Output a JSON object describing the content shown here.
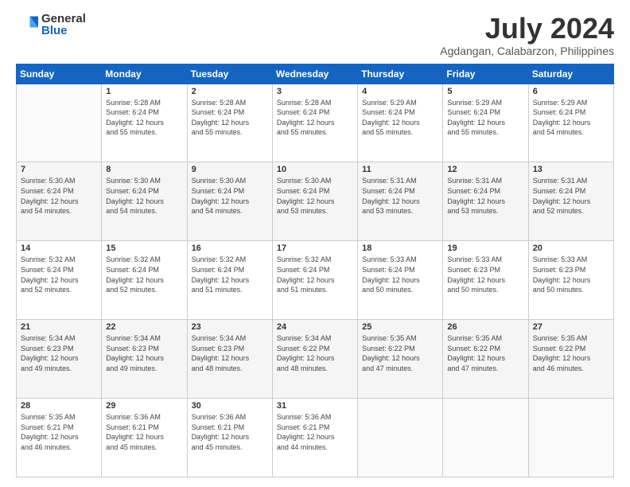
{
  "logo": {
    "general": "General",
    "blue": "Blue"
  },
  "title": "July 2024",
  "location": "Agdangan, Calabarzon, Philippines",
  "weekdays": [
    "Sunday",
    "Monday",
    "Tuesday",
    "Wednesday",
    "Thursday",
    "Friday",
    "Saturday"
  ],
  "weeks": [
    [
      {
        "day": "",
        "sunrise": "",
        "sunset": "",
        "daylight": ""
      },
      {
        "day": "1",
        "sunrise": "Sunrise: 5:28 AM",
        "sunset": "Sunset: 6:24 PM",
        "daylight": "Daylight: 12 hours and 55 minutes."
      },
      {
        "day": "2",
        "sunrise": "Sunrise: 5:28 AM",
        "sunset": "Sunset: 6:24 PM",
        "daylight": "Daylight: 12 hours and 55 minutes."
      },
      {
        "day": "3",
        "sunrise": "Sunrise: 5:28 AM",
        "sunset": "Sunset: 6:24 PM",
        "daylight": "Daylight: 12 hours and 55 minutes."
      },
      {
        "day": "4",
        "sunrise": "Sunrise: 5:29 AM",
        "sunset": "Sunset: 6:24 PM",
        "daylight": "Daylight: 12 hours and 55 minutes."
      },
      {
        "day": "5",
        "sunrise": "Sunrise: 5:29 AM",
        "sunset": "Sunset: 6:24 PM",
        "daylight": "Daylight: 12 hours and 55 minutes."
      },
      {
        "day": "6",
        "sunrise": "Sunrise: 5:29 AM",
        "sunset": "Sunset: 6:24 PM",
        "daylight": "Daylight: 12 hours and 54 minutes."
      }
    ],
    [
      {
        "day": "7",
        "sunrise": "Sunrise: 5:30 AM",
        "sunset": "Sunset: 6:24 PM",
        "daylight": "Daylight: 12 hours and 54 minutes."
      },
      {
        "day": "8",
        "sunrise": "Sunrise: 5:30 AM",
        "sunset": "Sunset: 6:24 PM",
        "daylight": "Daylight: 12 hours and 54 minutes."
      },
      {
        "day": "9",
        "sunrise": "Sunrise: 5:30 AM",
        "sunset": "Sunset: 6:24 PM",
        "daylight": "Daylight: 12 hours and 54 minutes."
      },
      {
        "day": "10",
        "sunrise": "Sunrise: 5:30 AM",
        "sunset": "Sunset: 6:24 PM",
        "daylight": "Daylight: 12 hours and 53 minutes."
      },
      {
        "day": "11",
        "sunrise": "Sunrise: 5:31 AM",
        "sunset": "Sunset: 6:24 PM",
        "daylight": "Daylight: 12 hours and 53 minutes."
      },
      {
        "day": "12",
        "sunrise": "Sunrise: 5:31 AM",
        "sunset": "Sunset: 6:24 PM",
        "daylight": "Daylight: 12 hours and 53 minutes."
      },
      {
        "day": "13",
        "sunrise": "Sunrise: 5:31 AM",
        "sunset": "Sunset: 6:24 PM",
        "daylight": "Daylight: 12 hours and 52 minutes."
      }
    ],
    [
      {
        "day": "14",
        "sunrise": "Sunrise: 5:32 AM",
        "sunset": "Sunset: 6:24 PM",
        "daylight": "Daylight: 12 hours and 52 minutes."
      },
      {
        "day": "15",
        "sunrise": "Sunrise: 5:32 AM",
        "sunset": "Sunset: 6:24 PM",
        "daylight": "Daylight: 12 hours and 52 minutes."
      },
      {
        "day": "16",
        "sunrise": "Sunrise: 5:32 AM",
        "sunset": "Sunset: 6:24 PM",
        "daylight": "Daylight: 12 hours and 51 minutes."
      },
      {
        "day": "17",
        "sunrise": "Sunrise: 5:32 AM",
        "sunset": "Sunset: 6:24 PM",
        "daylight": "Daylight: 12 hours and 51 minutes."
      },
      {
        "day": "18",
        "sunrise": "Sunrise: 5:33 AM",
        "sunset": "Sunset: 6:24 PM",
        "daylight": "Daylight: 12 hours and 50 minutes."
      },
      {
        "day": "19",
        "sunrise": "Sunrise: 5:33 AM",
        "sunset": "Sunset: 6:23 PM",
        "daylight": "Daylight: 12 hours and 50 minutes."
      },
      {
        "day": "20",
        "sunrise": "Sunrise: 5:33 AM",
        "sunset": "Sunset: 6:23 PM",
        "daylight": "Daylight: 12 hours and 50 minutes."
      }
    ],
    [
      {
        "day": "21",
        "sunrise": "Sunrise: 5:34 AM",
        "sunset": "Sunset: 6:23 PM",
        "daylight": "Daylight: 12 hours and 49 minutes."
      },
      {
        "day": "22",
        "sunrise": "Sunrise: 5:34 AM",
        "sunset": "Sunset: 6:23 PM",
        "daylight": "Daylight: 12 hours and 49 minutes."
      },
      {
        "day": "23",
        "sunrise": "Sunrise: 5:34 AM",
        "sunset": "Sunset: 6:23 PM",
        "daylight": "Daylight: 12 hours and 48 minutes."
      },
      {
        "day": "24",
        "sunrise": "Sunrise: 5:34 AM",
        "sunset": "Sunset: 6:22 PM",
        "daylight": "Daylight: 12 hours and 48 minutes."
      },
      {
        "day": "25",
        "sunrise": "Sunrise: 5:35 AM",
        "sunset": "Sunset: 6:22 PM",
        "daylight": "Daylight: 12 hours and 47 minutes."
      },
      {
        "day": "26",
        "sunrise": "Sunrise: 5:35 AM",
        "sunset": "Sunset: 6:22 PM",
        "daylight": "Daylight: 12 hours and 47 minutes."
      },
      {
        "day": "27",
        "sunrise": "Sunrise: 5:35 AM",
        "sunset": "Sunset: 6:22 PM",
        "daylight": "Daylight: 12 hours and 46 minutes."
      }
    ],
    [
      {
        "day": "28",
        "sunrise": "Sunrise: 5:35 AM",
        "sunset": "Sunset: 6:21 PM",
        "daylight": "Daylight: 12 hours and 46 minutes."
      },
      {
        "day": "29",
        "sunrise": "Sunrise: 5:36 AM",
        "sunset": "Sunset: 6:21 PM",
        "daylight": "Daylight: 12 hours and 45 minutes."
      },
      {
        "day": "30",
        "sunrise": "Sunrise: 5:36 AM",
        "sunset": "Sunset: 6:21 PM",
        "daylight": "Daylight: 12 hours and 45 minutes."
      },
      {
        "day": "31",
        "sunrise": "Sunrise: 5:36 AM",
        "sunset": "Sunset: 6:21 PM",
        "daylight": "Daylight: 12 hours and 44 minutes."
      },
      {
        "day": "",
        "sunrise": "",
        "sunset": "",
        "daylight": ""
      },
      {
        "day": "",
        "sunrise": "",
        "sunset": "",
        "daylight": ""
      },
      {
        "day": "",
        "sunrise": "",
        "sunset": "",
        "daylight": ""
      }
    ]
  ]
}
